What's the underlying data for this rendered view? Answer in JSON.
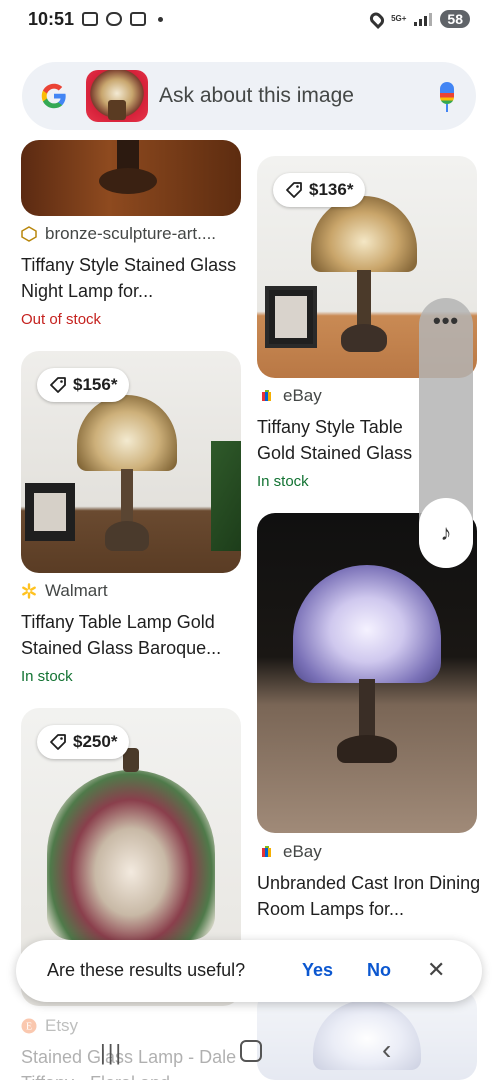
{
  "status": {
    "time": "10:51",
    "network": "5G+",
    "battery": "58"
  },
  "search": {
    "placeholder": "Ask about this image"
  },
  "results": [
    {
      "source": "bronze-sculpture-art....",
      "title": "Tiffany Style Stained Glass Night Lamp for...",
      "stock": "Out of stock"
    },
    {
      "price": "$136*",
      "source": "eBay",
      "title": "Tiffany Style Table Gold Stained Glass",
      "stock": "In stock"
    },
    {
      "price": "$156*",
      "source": "Walmart",
      "title": "Tiffany Table Lamp Gold Stained Glass Baroque...",
      "stock": "In stock"
    },
    {
      "source": "eBay",
      "title": "Unbranded Cast Iron Dining Room Lamps for..."
    },
    {
      "price": "$250*",
      "source": "Etsy",
      "title": "Stained Glass Lamp - Dale Tiffany - Floral and"
    }
  ],
  "feedback": {
    "question": "Are these results useful?",
    "yes": "Yes",
    "no": "No",
    "close": "✕"
  },
  "side_panel": {
    "menu": "•••",
    "music": "♪"
  },
  "nav": {
    "recent": "|||",
    "back": "‹"
  }
}
